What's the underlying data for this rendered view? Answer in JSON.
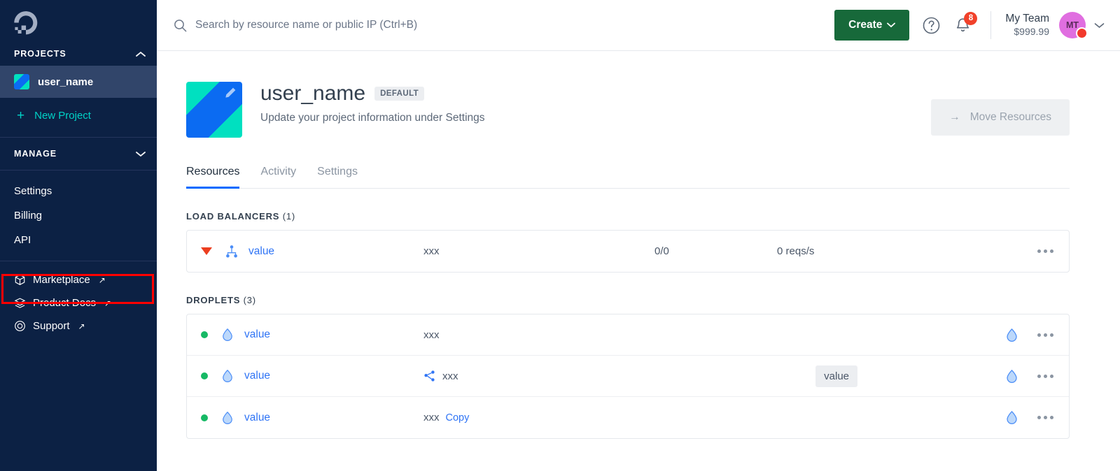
{
  "sidebar": {
    "logo": "digitalocean-logo",
    "projects_label": "PROJECTS",
    "selected_project": "user_name",
    "new_project_label": "New Project",
    "manage_label": "MANAGE",
    "manage_items": [
      {
        "label": "Settings"
      },
      {
        "label": "Billing"
      },
      {
        "label": "API"
      }
    ],
    "external_items": [
      {
        "label": "Marketplace",
        "icon": "cube-icon",
        "arrow": "↗"
      },
      {
        "label": "Product Docs",
        "icon": "layers-icon",
        "arrow": "↗"
      },
      {
        "label": "Support",
        "icon": "lifebuoy-icon",
        "arrow": "↗"
      }
    ],
    "highlighted_item": "API"
  },
  "topbar": {
    "search_placeholder": "Search by resource name or public IP (Ctrl+B)",
    "create_label": "Create",
    "create_caret": "⌄",
    "help_icon": "question-circle-icon",
    "bell_icon": "bell-icon",
    "notification_count": "8",
    "account_name": "My Team",
    "account_balance": "$999.99",
    "avatar_initials": "MT",
    "account_caret": "⌄"
  },
  "project": {
    "title": "user_name",
    "badge": "DEFAULT",
    "subtitle": "Update your project information under Settings",
    "edit_icon": "pencil-icon",
    "move_resources_label": "Move Resources",
    "move_resources_arrow": "→"
  },
  "tabs": [
    {
      "label": "Resources",
      "active": true
    },
    {
      "label": "Activity",
      "active": false
    },
    {
      "label": "Settings",
      "active": false
    }
  ],
  "sections": [
    {
      "name": "LOAD BALANCERS",
      "count": "(1)",
      "rows": [
        {
          "status": "down",
          "type_icon": "load-balancer-icon",
          "name": "value",
          "ip": "xxx",
          "nodes": "0/0",
          "rate": "0 reqs/s"
        }
      ]
    },
    {
      "name": "DROPLETS",
      "count": "(3)",
      "rows": [
        {
          "status": "up",
          "type_icon": "droplet-icon",
          "name": "value",
          "ip": "xxx",
          "tag": "",
          "copy": "",
          "has_share_icon": false,
          "backup_icon": "droplet-outline-icon"
        },
        {
          "status": "up",
          "type_icon": "droplet-icon",
          "name": "value",
          "ip": "xxx",
          "tag": "value",
          "copy": "",
          "has_share_icon": true,
          "backup_icon": "droplet-outline-icon"
        },
        {
          "status": "up",
          "type_icon": "droplet-icon",
          "name": "value",
          "ip": "xxx",
          "tag": "",
          "copy": "Copy",
          "has_share_icon": false,
          "backup_icon": "droplet-outline-icon"
        }
      ]
    }
  ],
  "colors": {
    "sidebar_bg": "#0c2144",
    "sidebar_active": "#31456a",
    "accent_teal": "#00d3c7",
    "link_blue": "#2f74f5",
    "create_green": "#17693a",
    "status_up": "#16b965",
    "status_down": "#ec3e1f",
    "annotation_red": "#ff0000",
    "tab_active": "#0069ff"
  }
}
